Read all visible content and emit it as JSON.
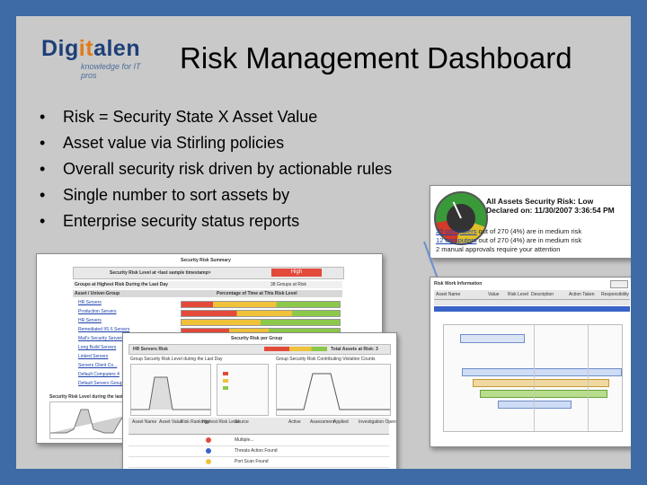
{
  "logo": {
    "brand_pre": "Dig",
    "brand_it": "it",
    "brand_post": "alen",
    "tagline": "knowledge for IT pros"
  },
  "title": "Risk Management Dashboard",
  "bullets": [
    "Risk = Security State X Asset Value",
    "Asset value via Stirling policies",
    "Overall security risk driven by actionable rules",
    "Single number to sort assets by",
    "Enterprise security status reports"
  ],
  "risk_panel": {
    "heading_1": "All Assets Security Risk: Low",
    "heading_2": "Declared on: 11/30/2007 3:36:54 PM",
    "line_1_link": "20 computers",
    "line_1_text": " out of 270 (4%) are in medium risk",
    "line_2_link": "12 computers",
    "line_2_text": " out of 270 (4%) are in medium risk",
    "line_3": "2 manual approvals require your attention"
  },
  "summary_panel": {
    "header": "Security Risk Summary",
    "risk_level": "Security Risk Level at <last sample timestamp>",
    "risk_badge": "High",
    "groups_label": "Groups at Highest Risk During the Last Day",
    "groups_count": "38 Groups at Risk",
    "col_asset": "Asset / Univer-Group",
    "col_percent": "Percentage of Time at This Risk Level",
    "groups": [
      "HR Servers",
      "Production Servers",
      "HR Servers",
      "Remediated IIS 6 Servers",
      "Mail's Security Servers",
      "Long Build Servers",
      "Linked Servers",
      "Servers Client Co...",
      "Default Computers 4",
      "Default Servers Group"
    ],
    "trend_label": "Security Risk Level during the last Day"
  },
  "group_panel": {
    "header": "Security Risk per Group",
    "group_name": "HR Servers Risk",
    "total": "Total Assets at Risk: 3",
    "chart_title_1": "Group Security Risk Level during the Last Day",
    "chart_title_2": "Group Security Risk Contributing Violation Counts",
    "table_headers": [
      "Asset Name",
      "Asset Value",
      "Risk Rankings",
      "Highest Risk Level",
      "Source",
      "Active",
      "Assessment",
      "Applied",
      "Investigation Opened"
    ],
    "rows": [
      "Multiple...",
      "Threats Action Found",
      "Port Scan Found"
    ]
  },
  "timeline_panel": {
    "title": "Risk Work Information",
    "headers": [
      "Asset Name",
      "Value",
      "Risk Level",
      "Description",
      "Action Taken",
      "Responsibility"
    ]
  }
}
